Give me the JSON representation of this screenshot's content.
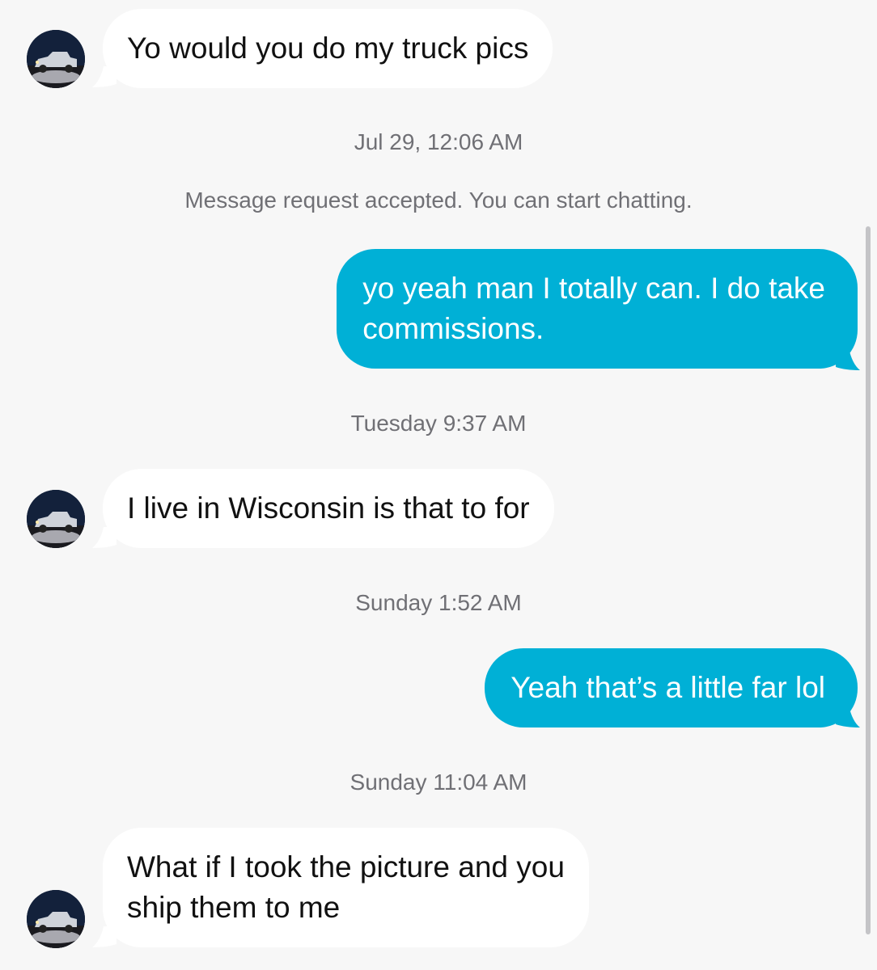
{
  "colors": {
    "background": "#f7f7f7",
    "incoming": "#ffffff",
    "outgoing": "#00b0d6",
    "timestamp": "#707075"
  },
  "contact": {
    "avatar_icon": "truck-photo-avatar-icon"
  },
  "messages": [
    {
      "dir": "in",
      "text": "Yo would you do my truck pics"
    },
    {
      "stamp": "Jul 29, 12:06 AM"
    },
    {
      "system": "Message request accepted. You can start chatting."
    },
    {
      "dir": "out",
      "lines": [
        "yo yeah man I totally can. I do take",
        "commissions."
      ]
    },
    {
      "stamp": "Tuesday 9:37 AM"
    },
    {
      "dir": "in",
      "text": "I live in Wisconsin is that to for"
    },
    {
      "stamp": "Sunday 1:52 AM"
    },
    {
      "dir": "out",
      "text": "Yeah that’s a little far lol"
    },
    {
      "stamp": "Sunday 11:04 AM"
    },
    {
      "dir": "in",
      "lines": [
        "What if I took the picture and you",
        "ship them to me"
      ]
    }
  ]
}
